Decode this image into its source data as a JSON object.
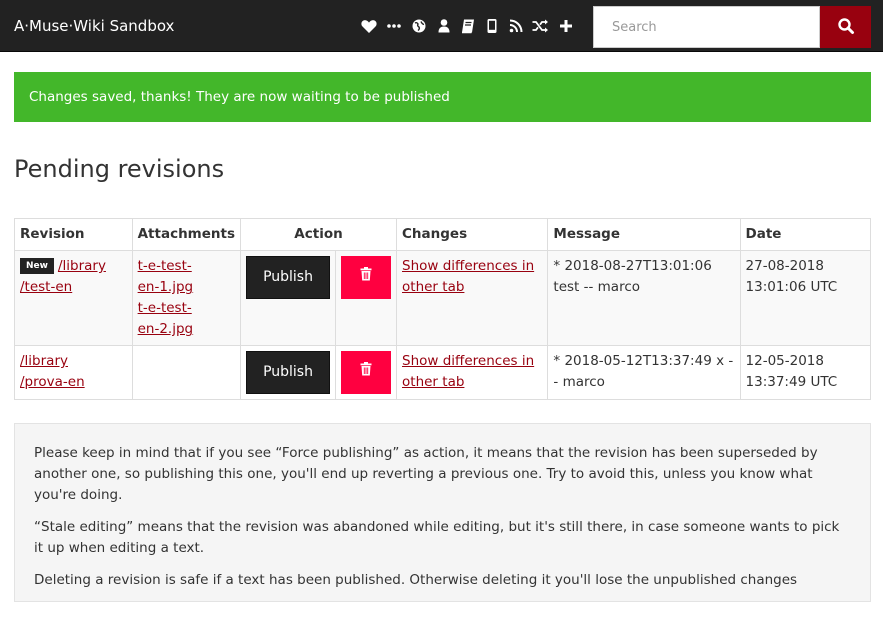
{
  "navbar": {
    "brand": "A·Muse·Wiki Sandbox",
    "icons": [
      "heart-icon",
      "ellipsis-icon",
      "globe-icon",
      "user-icon",
      "book-icon",
      "tablet-icon",
      "rss-icon",
      "shuffle-icon",
      "plus-icon"
    ],
    "search": {
      "placeholder": "Search",
      "value": ""
    }
  },
  "alert": {
    "text": "Changes saved, thanks! They are now waiting to be published"
  },
  "page_title": "Pending revisions",
  "table": {
    "headers": [
      "Revision",
      "Attachments",
      "Action",
      "Changes",
      "Message",
      "Date"
    ],
    "rows": [
      {
        "badge": "New",
        "revision_line1": "/library",
        "revision_line2": "/test-en",
        "attachments": [
          "t-e-test-en-1.jpg",
          "t-e-test-en-2.jpg"
        ],
        "attachment1_l1": "t-e-test-",
        "attachment1_l2": "en-1.jpg",
        "attachment2_l1": "t-e-test-",
        "attachment2_l2": "en-2.jpg",
        "publish_label": "Publish",
        "changes_link": "Show differences in other tab",
        "message": "* 2018-08-27T13:01:06 test -- marco",
        "date": "27-08-2018 13:01:06 UTC"
      },
      {
        "badge": "",
        "revision_line1": "/library",
        "revision_line2": "/prova-en",
        "attachments": [],
        "publish_label": "Publish",
        "changes_link": "Show differences in other tab",
        "message": "* 2018-05-12T13:37:49 x -- marco",
        "date": "12-05-2018 13:37:49 UTC"
      }
    ]
  },
  "notes": {
    "p1": "Please keep in mind that if you see “Force publishing” as action, it means that the revision has been superseded by another one, so publishing this one, you'll end up reverting a previous one. Try to avoid this, unless you know what you're doing.",
    "p2": "“Stale editing” means that the revision was abandoned while editing, but it's still there, in case someone wants to pick it up when editing a text.",
    "p3": "Deleting a revision is safe if a text has been published. Otherwise deleting it you'll lose the unpublished changes"
  },
  "colors": {
    "navbar_bg": "#222222",
    "accent": "#98010f",
    "success": "#43b72a",
    "danger": "#ff0040"
  }
}
